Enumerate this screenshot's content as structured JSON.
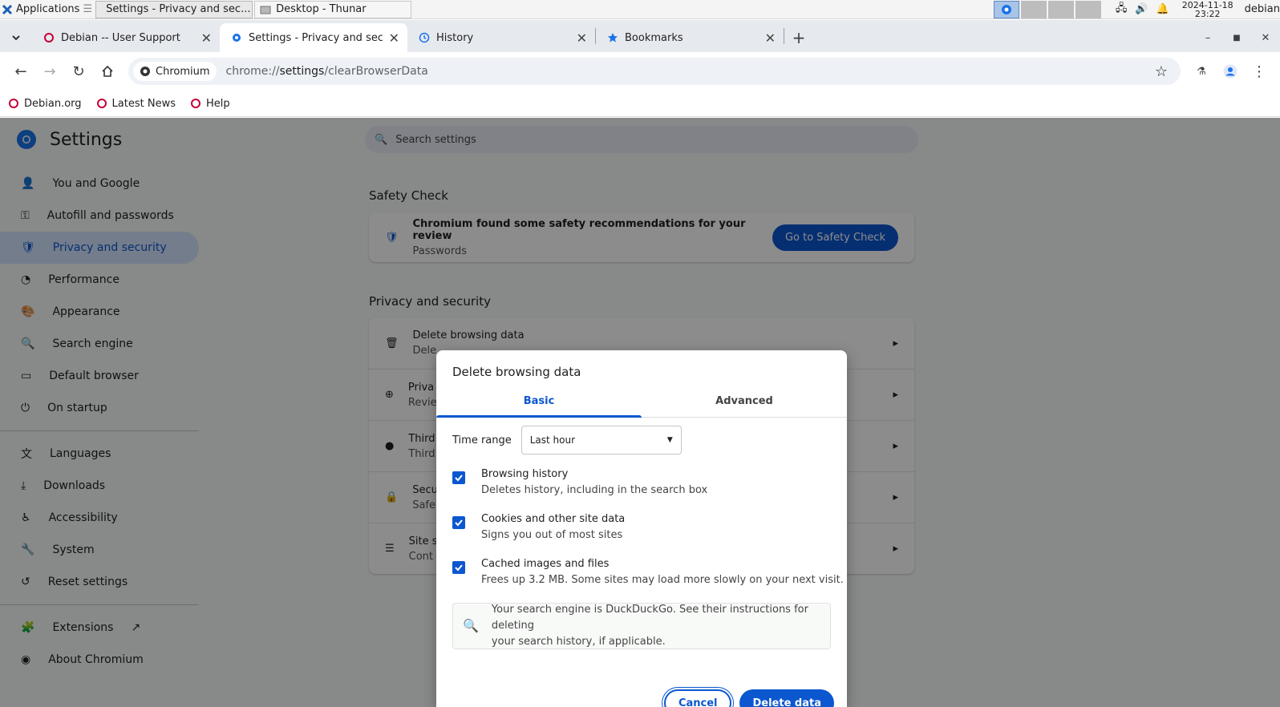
{
  "taskbar": {
    "apps_label": "Applications",
    "tasks": [
      {
        "label": "Settings - Privacy and sec..."
      },
      {
        "label": "Desktop - Thunar"
      }
    ],
    "date": "2024-11-18",
    "time": "23:22",
    "user": "debian"
  },
  "tabs": [
    {
      "title": "Debian -- User Support"
    },
    {
      "title": "Settings - Privacy and secur"
    },
    {
      "title": "History"
    },
    {
      "title": "Bookmarks"
    }
  ],
  "toolbar": {
    "chip_label": "Chromium",
    "url_prefix": "chrome://",
    "url_host": "settings",
    "url_path": "/clearBrowserData"
  },
  "bookmarks": [
    {
      "label": "Debian.org"
    },
    {
      "label": "Latest News"
    },
    {
      "label": "Help"
    }
  ],
  "settings": {
    "title": "Settings",
    "search_placeholder": "Search settings",
    "nav": [
      {
        "label": "You and Google",
        "icon": "person-icon"
      },
      {
        "label": "Autofill and passwords",
        "icon": "key-icon"
      },
      {
        "label": "Privacy and security",
        "icon": "shield-icon"
      },
      {
        "label": "Performance",
        "icon": "speedometer-icon"
      },
      {
        "label": "Appearance",
        "icon": "palette-icon"
      },
      {
        "label": "Search engine",
        "icon": "search-icon"
      },
      {
        "label": "Default browser",
        "icon": "browser-icon"
      },
      {
        "label": "On startup",
        "icon": "power-icon"
      },
      {
        "label": "Languages",
        "icon": "translate-icon"
      },
      {
        "label": "Downloads",
        "icon": "download-icon"
      },
      {
        "label": "Accessibility",
        "icon": "accessibility-icon"
      },
      {
        "label": "System",
        "icon": "wrench-icon"
      },
      {
        "label": "Reset settings",
        "icon": "reset-icon"
      },
      {
        "label": "Extensions",
        "icon": "puzzle-icon"
      },
      {
        "label": "About Chromium",
        "icon": "chromium-icon"
      }
    ],
    "safety_check_title": "Safety Check",
    "safety_msg": "Chromium found some safety recommendations for your review",
    "safety_sub": "Passwords",
    "safety_button": "Go to Safety Check",
    "privacy_title": "Privacy and security",
    "privacy_rows": [
      {
        "t1": "Delete browsing data",
        "t2": "Dele"
      },
      {
        "t1": "Priva",
        "t2": "Revie"
      },
      {
        "t1": "Third",
        "t2": "Third"
      },
      {
        "t1": "Secu",
        "t2": "Safe"
      },
      {
        "t1": "Site s",
        "t2": "Cont"
      }
    ]
  },
  "dialog": {
    "title": "Delete browsing data",
    "tab_basic": "Basic",
    "tab_advanced": "Advanced",
    "time_range_label": "Time range",
    "time_range_value": "Last hour",
    "options": [
      {
        "title": "Browsing history",
        "desc": "Deletes history, including in the search box",
        "checked": true
      },
      {
        "title": "Cookies and other site data",
        "desc": "Signs you out of most sites",
        "checked": true
      },
      {
        "title": "Cached images and files",
        "desc": "Frees up 3.2 MB. Some sites may load more slowly on your next visit.",
        "checked": true
      }
    ],
    "note_line1": "Your search engine is DuckDuckGo. See their instructions for deleting",
    "note_line2": "your search history, if applicable.",
    "cancel": "Cancel",
    "delete": "Delete data"
  },
  "colors": {
    "accent": "#0b57d0",
    "debian_red": "#c70036"
  }
}
